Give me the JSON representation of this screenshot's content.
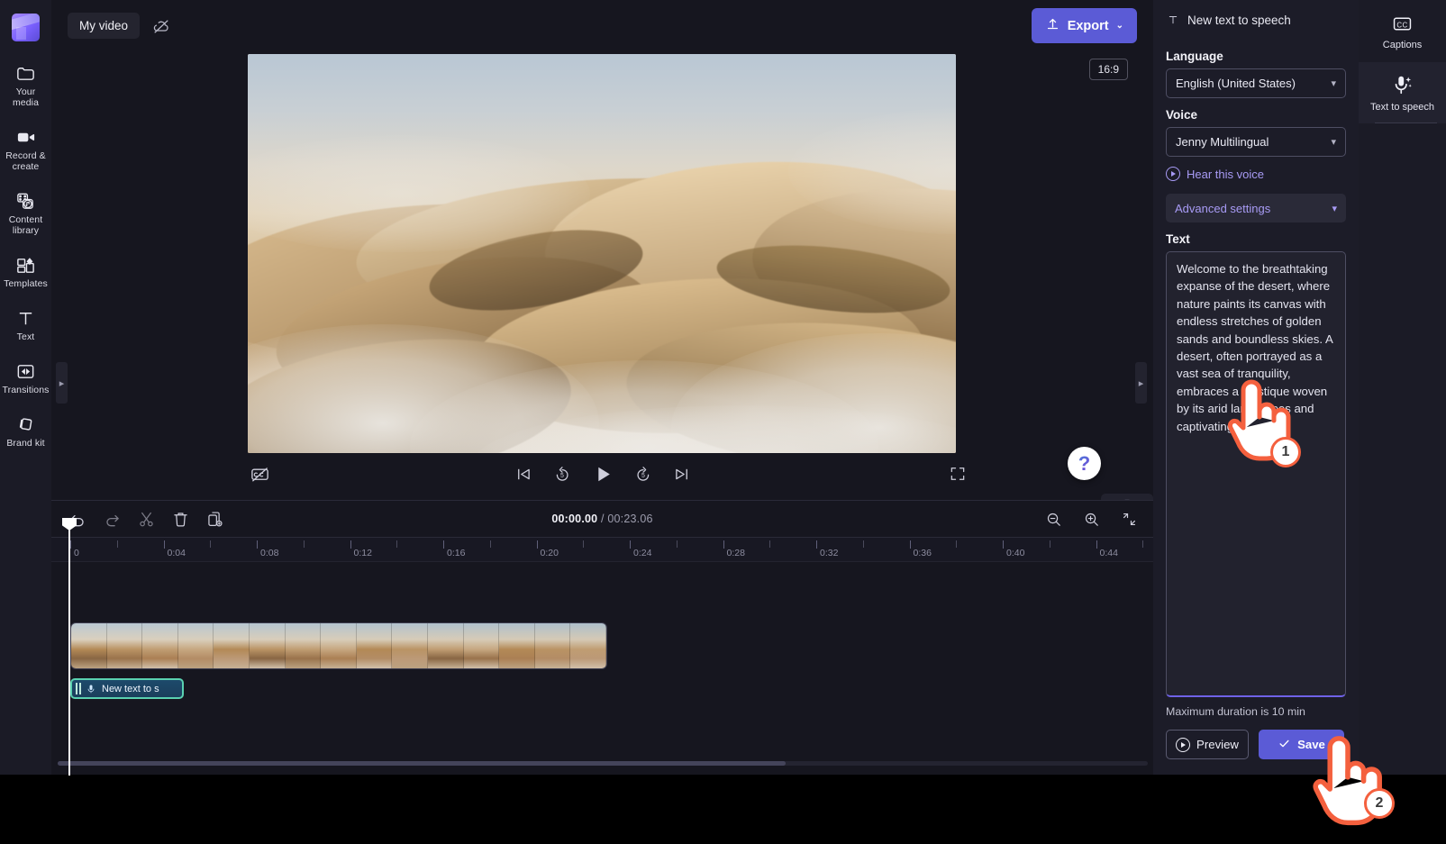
{
  "app": {
    "name": "Clipchamp",
    "accent": "#5b5bd6",
    "panel_bg": "#1c1c28"
  },
  "topbar": {
    "project_name": "My video",
    "cloud_icon": "cloud-off-icon",
    "export_label": "Export",
    "export_icon": "upload-icon",
    "export_chevron": "⌄"
  },
  "left_rail": {
    "logo": "clipchamp-logo",
    "items": [
      {
        "label": "Your media",
        "icon": "folder-icon",
        "name": "your-media"
      },
      {
        "label": "Record & create",
        "icon": "video-camera-icon",
        "name": "record-create"
      },
      {
        "label": "Content library",
        "icon": "content-library-icon",
        "name": "content-library"
      },
      {
        "label": "Templates",
        "icon": "templates-icon",
        "name": "templates"
      },
      {
        "label": "Text",
        "icon": "text-icon",
        "name": "text"
      },
      {
        "label": "Transitions",
        "icon": "transitions-icon",
        "name": "transitions"
      },
      {
        "label": "Brand kit",
        "icon": "brand-kit-icon",
        "name": "brand-kit"
      }
    ]
  },
  "preview": {
    "aspect_ratio": "16:9",
    "captions_toggle_icon": "captions-off-icon",
    "controls": [
      {
        "name": "skip-to-start",
        "icon": "skip-previous-icon"
      },
      {
        "name": "rewind-5s",
        "icon": "rewind-5-icon"
      },
      {
        "name": "play",
        "icon": "play-icon"
      },
      {
        "name": "forward-5s",
        "icon": "forward-5-icon"
      },
      {
        "name": "skip-to-end",
        "icon": "skip-next-icon"
      }
    ],
    "fullscreen_icon": "fullscreen-icon",
    "help_icon": "question-mark-icon",
    "collapse_icon": "chevron-down-icon"
  },
  "timeline": {
    "tools": [
      {
        "name": "undo",
        "icon": "undo-icon"
      },
      {
        "name": "redo",
        "icon": "redo-icon"
      },
      {
        "name": "split",
        "icon": "scissors-icon"
      },
      {
        "name": "delete",
        "icon": "trash-icon"
      },
      {
        "name": "duplicate",
        "icon": "duplicate-icon"
      }
    ],
    "current_time": "00:00.00",
    "separator": "/",
    "total_time": "00:23.06",
    "zoom_out_icon": "zoom-out-icon",
    "zoom_in_icon": "zoom-in-icon",
    "fit_icon": "fit-to-screen-icon",
    "ruler_labels": [
      "0",
      "0:04",
      "0:08",
      "0:12",
      "0:16",
      "0:20",
      "0:24",
      "0:28",
      "0:32",
      "0:36",
      "0:40",
      "0:44"
    ],
    "audio_clip_label": "New text to s",
    "audio_clip_icon": "text-to-speech-icon"
  },
  "right_panel": {
    "header_title": "New text to speech",
    "header_icon": "text-icon",
    "language_label": "Language",
    "language_value": "English (United States)",
    "voice_label": "Voice",
    "voice_value": "Jenny Multilingual",
    "hear_voice_label": "Hear this voice",
    "hear_voice_icon": "play-circle-icon",
    "advanced_settings_label": "Advanced settings",
    "text_label": "Text",
    "text_value": "Welcome to the breathtaking expanse of the desert, where nature paints its canvas with endless stretches of golden sands and boundless skies. A desert, often portrayed as a vast sea of tranquility, embraces a mystique woven by its arid landscapes and captivating",
    "max_duration_note": "Maximum duration is 10 min",
    "preview_label": "Preview",
    "preview_icon": "play-circle-icon",
    "save_label": "Save",
    "save_icon": "check-icon"
  },
  "right_rail": {
    "items": [
      {
        "label": "Captions",
        "icon": "closed-captions-icon",
        "name": "captions",
        "active": false
      },
      {
        "label": "Text to speech",
        "icon": "microphone-sparkle-icon",
        "name": "text-to-speech",
        "active": true
      }
    ]
  },
  "annotations": {
    "steps": [
      {
        "number": "1",
        "target": "text-textarea"
      },
      {
        "number": "2",
        "target": "save-button"
      }
    ]
  }
}
